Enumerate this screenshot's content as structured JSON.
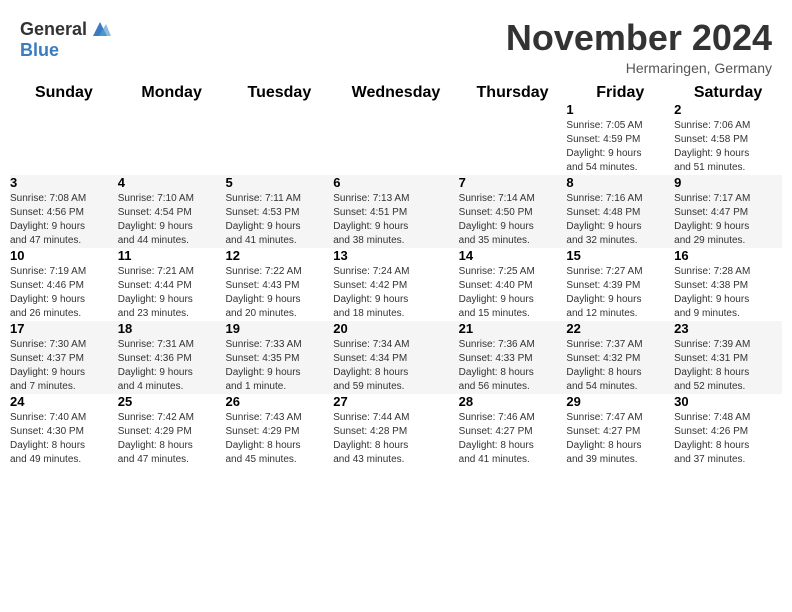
{
  "header": {
    "logo_general": "General",
    "logo_blue": "Blue",
    "month_title": "November 2024",
    "location": "Hermaringen, Germany"
  },
  "days_of_week": [
    "Sunday",
    "Monday",
    "Tuesday",
    "Wednesday",
    "Thursday",
    "Friday",
    "Saturday"
  ],
  "weeks": [
    [
      {
        "day": "",
        "info": ""
      },
      {
        "day": "",
        "info": ""
      },
      {
        "day": "",
        "info": ""
      },
      {
        "day": "",
        "info": ""
      },
      {
        "day": "",
        "info": ""
      },
      {
        "day": "1",
        "info": "Sunrise: 7:05 AM\nSunset: 4:59 PM\nDaylight: 9 hours\nand 54 minutes."
      },
      {
        "day": "2",
        "info": "Sunrise: 7:06 AM\nSunset: 4:58 PM\nDaylight: 9 hours\nand 51 minutes."
      }
    ],
    [
      {
        "day": "3",
        "info": "Sunrise: 7:08 AM\nSunset: 4:56 PM\nDaylight: 9 hours\nand 47 minutes."
      },
      {
        "day": "4",
        "info": "Sunrise: 7:10 AM\nSunset: 4:54 PM\nDaylight: 9 hours\nand 44 minutes."
      },
      {
        "day": "5",
        "info": "Sunrise: 7:11 AM\nSunset: 4:53 PM\nDaylight: 9 hours\nand 41 minutes."
      },
      {
        "day": "6",
        "info": "Sunrise: 7:13 AM\nSunset: 4:51 PM\nDaylight: 9 hours\nand 38 minutes."
      },
      {
        "day": "7",
        "info": "Sunrise: 7:14 AM\nSunset: 4:50 PM\nDaylight: 9 hours\nand 35 minutes."
      },
      {
        "day": "8",
        "info": "Sunrise: 7:16 AM\nSunset: 4:48 PM\nDaylight: 9 hours\nand 32 minutes."
      },
      {
        "day": "9",
        "info": "Sunrise: 7:17 AM\nSunset: 4:47 PM\nDaylight: 9 hours\nand 29 minutes."
      }
    ],
    [
      {
        "day": "10",
        "info": "Sunrise: 7:19 AM\nSunset: 4:46 PM\nDaylight: 9 hours\nand 26 minutes."
      },
      {
        "day": "11",
        "info": "Sunrise: 7:21 AM\nSunset: 4:44 PM\nDaylight: 9 hours\nand 23 minutes."
      },
      {
        "day": "12",
        "info": "Sunrise: 7:22 AM\nSunset: 4:43 PM\nDaylight: 9 hours\nand 20 minutes."
      },
      {
        "day": "13",
        "info": "Sunrise: 7:24 AM\nSunset: 4:42 PM\nDaylight: 9 hours\nand 18 minutes."
      },
      {
        "day": "14",
        "info": "Sunrise: 7:25 AM\nSunset: 4:40 PM\nDaylight: 9 hours\nand 15 minutes."
      },
      {
        "day": "15",
        "info": "Sunrise: 7:27 AM\nSunset: 4:39 PM\nDaylight: 9 hours\nand 12 minutes."
      },
      {
        "day": "16",
        "info": "Sunrise: 7:28 AM\nSunset: 4:38 PM\nDaylight: 9 hours\nand 9 minutes."
      }
    ],
    [
      {
        "day": "17",
        "info": "Sunrise: 7:30 AM\nSunset: 4:37 PM\nDaylight: 9 hours\nand 7 minutes."
      },
      {
        "day": "18",
        "info": "Sunrise: 7:31 AM\nSunset: 4:36 PM\nDaylight: 9 hours\nand 4 minutes."
      },
      {
        "day": "19",
        "info": "Sunrise: 7:33 AM\nSunset: 4:35 PM\nDaylight: 9 hours\nand 1 minute."
      },
      {
        "day": "20",
        "info": "Sunrise: 7:34 AM\nSunset: 4:34 PM\nDaylight: 8 hours\nand 59 minutes."
      },
      {
        "day": "21",
        "info": "Sunrise: 7:36 AM\nSunset: 4:33 PM\nDaylight: 8 hours\nand 56 minutes."
      },
      {
        "day": "22",
        "info": "Sunrise: 7:37 AM\nSunset: 4:32 PM\nDaylight: 8 hours\nand 54 minutes."
      },
      {
        "day": "23",
        "info": "Sunrise: 7:39 AM\nSunset: 4:31 PM\nDaylight: 8 hours\nand 52 minutes."
      }
    ],
    [
      {
        "day": "24",
        "info": "Sunrise: 7:40 AM\nSunset: 4:30 PM\nDaylight: 8 hours\nand 49 minutes."
      },
      {
        "day": "25",
        "info": "Sunrise: 7:42 AM\nSunset: 4:29 PM\nDaylight: 8 hours\nand 47 minutes."
      },
      {
        "day": "26",
        "info": "Sunrise: 7:43 AM\nSunset: 4:29 PM\nDaylight: 8 hours\nand 45 minutes."
      },
      {
        "day": "27",
        "info": "Sunrise: 7:44 AM\nSunset: 4:28 PM\nDaylight: 8 hours\nand 43 minutes."
      },
      {
        "day": "28",
        "info": "Sunrise: 7:46 AM\nSunset: 4:27 PM\nDaylight: 8 hours\nand 41 minutes."
      },
      {
        "day": "29",
        "info": "Sunrise: 7:47 AM\nSunset: 4:27 PM\nDaylight: 8 hours\nand 39 minutes."
      },
      {
        "day": "30",
        "info": "Sunrise: 7:48 AM\nSunset: 4:26 PM\nDaylight: 8 hours\nand 37 minutes."
      }
    ]
  ]
}
